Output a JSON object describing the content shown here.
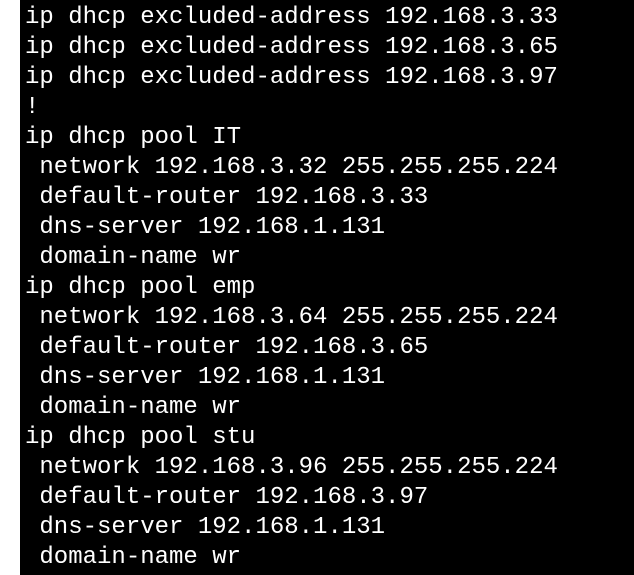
{
  "terminal": {
    "background": "#000000",
    "text_color": "#ffffff",
    "lines": [
      "ip dhcp excluded-address 192.168.3.33",
      "ip dhcp excluded-address 192.168.3.65",
      "ip dhcp excluded-address 192.168.3.97",
      "!",
      "ip dhcp pool IT",
      " network 192.168.3.32 255.255.255.224",
      " default-router 192.168.3.33",
      " dns-server 192.168.1.131",
      " domain-name wr",
      "ip dhcp pool emp",
      " network 192.168.3.64 255.255.255.224",
      " default-router 192.168.3.65",
      " dns-server 192.168.1.131",
      " domain-name wr",
      "ip dhcp pool stu",
      " network 192.168.3.96 255.255.255.224",
      " default-router 192.168.3.97",
      " dns-server 192.168.1.131",
      " domain-name wr"
    ]
  }
}
